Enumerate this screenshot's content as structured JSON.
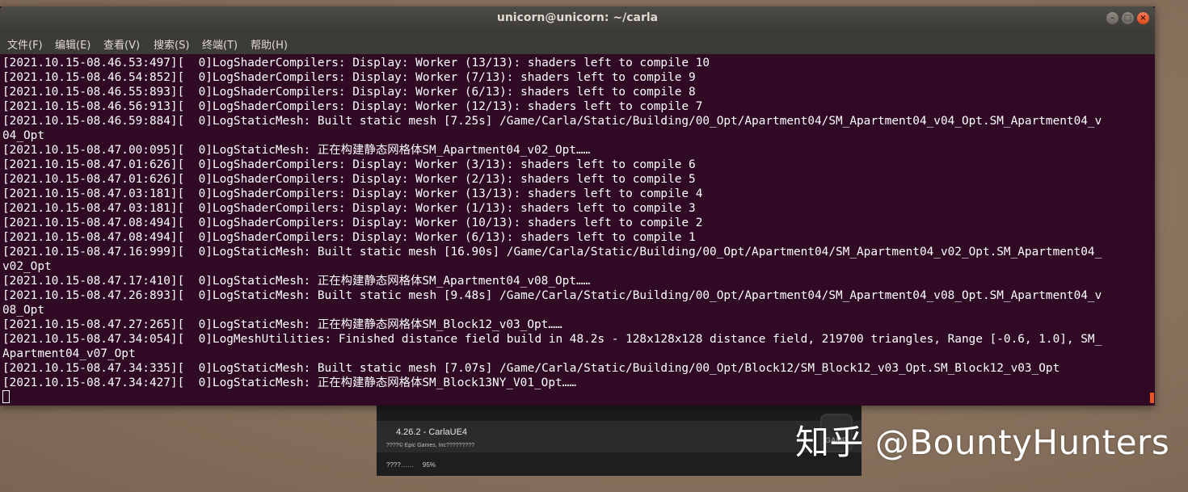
{
  "terminal": {
    "title": "unicorn@unicorn: ~/carla",
    "menu": [
      "文件(F)",
      "编辑(E)",
      "查看(V)",
      "搜索(S)",
      "终端(T)",
      "帮助(H)"
    ],
    "lines": [
      "[2021.10.15-08.46.53:497][  0]LogShaderCompilers: Display: Worker (13/13): shaders left to compile 10",
      "[2021.10.15-08.46.54:852][  0]LogShaderCompilers: Display: Worker (7/13): shaders left to compile 9",
      "[2021.10.15-08.46.55:893][  0]LogShaderCompilers: Display: Worker (6/13): shaders left to compile 8",
      "[2021.10.15-08.46.56:913][  0]LogShaderCompilers: Display: Worker (12/13): shaders left to compile 7",
      "[2021.10.15-08.46.59:884][  0]LogStaticMesh: Built static mesh [7.25s] /Game/Carla/Static/Building/00_Opt/Apartment04/SM_Apartment04_v04_Opt.SM_Apartment04_v",
      "04_Opt",
      "[2021.10.15-08.47.00:095][  0]LogStaticMesh: 正在构建静态网格体SM_Apartment04_v02_Opt……",
      "[2021.10.15-08.47.01:626][  0]LogShaderCompilers: Display: Worker (3/13): shaders left to compile 6",
      "[2021.10.15-08.47.01:626][  0]LogShaderCompilers: Display: Worker (2/13): shaders left to compile 5",
      "[2021.10.15-08.47.03:181][  0]LogShaderCompilers: Display: Worker (13/13): shaders left to compile 4",
      "[2021.10.15-08.47.03:181][  0]LogShaderCompilers: Display: Worker (1/13): shaders left to compile 3",
      "[2021.10.15-08.47.08:494][  0]LogShaderCompilers: Display: Worker (10/13): shaders left to compile 2",
      "[2021.10.15-08.47.08:494][  0]LogShaderCompilers: Display: Worker (6/13): shaders left to compile 1",
      "[2021.10.15-08.47.16:999][  0]LogStaticMesh: Built static mesh [16.90s] /Game/Carla/Static/Building/00_Opt/Apartment04/SM_Apartment04_v02_Opt.SM_Apartment04_",
      "v02_Opt",
      "[2021.10.15-08.47.17:410][  0]LogStaticMesh: 正在构建静态网格体SM_Apartment04_v08_Opt……",
      "[2021.10.15-08.47.26:893][  0]LogStaticMesh: Built static mesh [9.48s] /Game/Carla/Static/Building/00_Opt/Apartment04/SM_Apartment04_v08_Opt.SM_Apartment04_v",
      "08_Opt",
      "[2021.10.15-08.47.27:265][  0]LogStaticMesh: 正在构建静态网格体SM_Block12_v03_Opt……",
      "[2021.10.15-08.47.34:054][  0]LogMeshUtilities: Finished distance field build in 48.2s - 128x128x128 distance field, 219700 triangles, Range [-0.6, 1.0], SM_",
      "Apartment04_v07_Opt",
      "[2021.10.15-08.47.34:335][  0]LogStaticMesh: Built static mesh [7.07s] /Game/Carla/Static/Building/00_Opt/Block12/SM_Block12_v03_Opt.SM_Block12_v03_Opt",
      "[2021.10.15-08.47.34:427][  0]LogStaticMesh: 正在构建静态网格体SM_Block13NY_V01_Opt……"
    ],
    "colors": {
      "background": "#300a24",
      "text": "#ffffff",
      "accent": "#e95420"
    }
  },
  "splash": {
    "title": "4.26.2  -  CarlaUE4",
    "copyright": "????©  Epic Games, Inc?????????",
    "loading_text": "????……",
    "loading_percent": "95%"
  },
  "watermark": {
    "text": "知乎 @BountyHunters"
  }
}
